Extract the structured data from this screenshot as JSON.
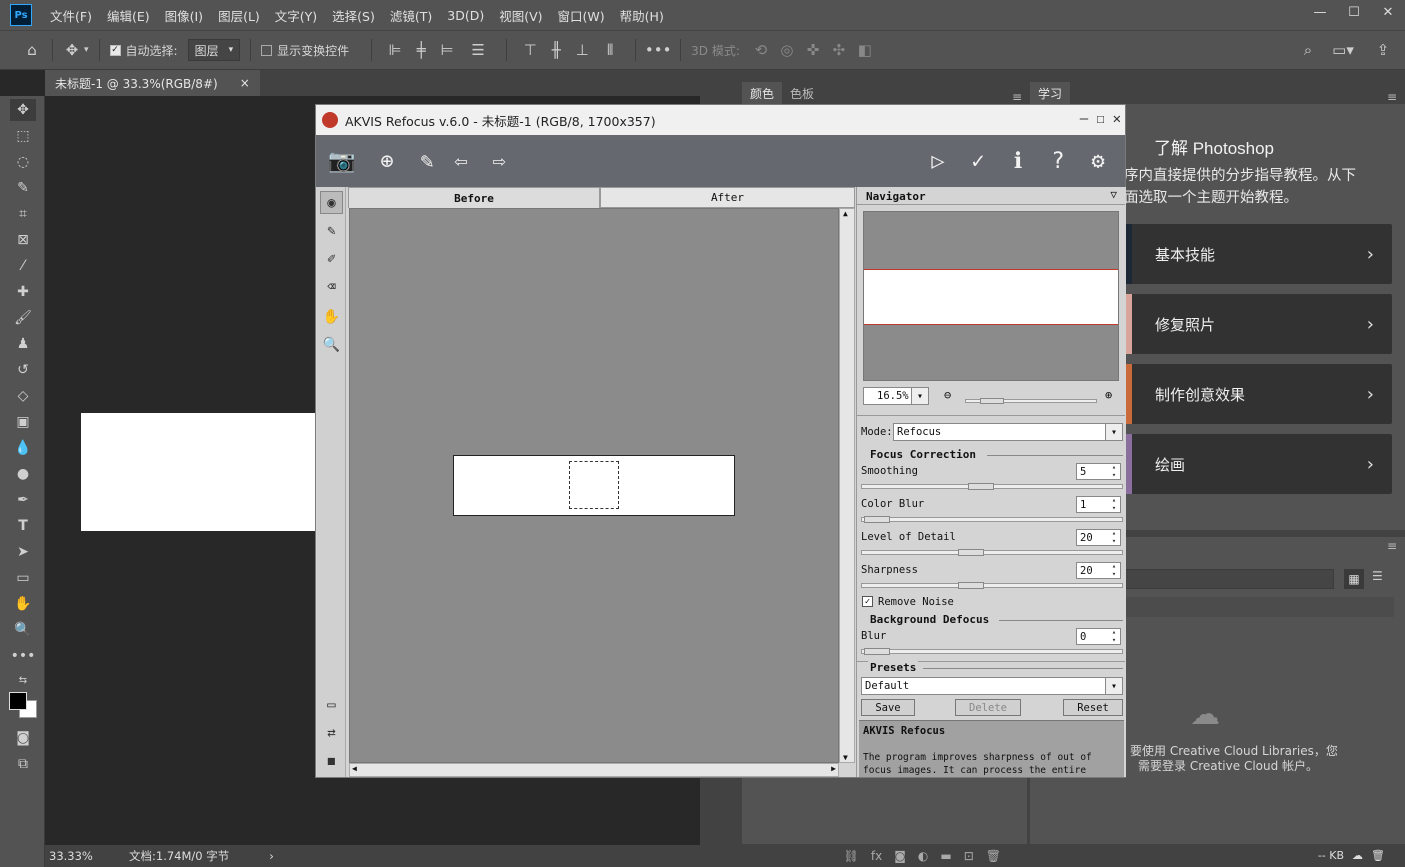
{
  "menubar": {
    "logo": "Ps",
    "items": [
      "文件(F)",
      "编辑(E)",
      "图像(I)",
      "图层(L)",
      "文字(Y)",
      "选择(S)",
      "滤镜(T)",
      "3D(D)",
      "视图(V)",
      "窗口(W)",
      "帮助(H)"
    ]
  },
  "options": {
    "auto_select_label": "自动选择:",
    "auto_select_target": "图层",
    "show_transform_label": "显示变换控件",
    "mode_3d_label": "3D 模式:"
  },
  "document": {
    "tab_title": "未标题-1 @ 33.3%(RGB/8#)",
    "tab_close": "×",
    "zoom": "33.33%",
    "doc_info": "文档:1.74M/0 字节",
    "status_arrow": "›"
  },
  "right_panels": {
    "color_tab": "颜色",
    "swatches_tab": "色板",
    "learn_tab": "学习",
    "learn_title": "了解 Photoshop",
    "learn_desc_line1": "序内直接提供的分步指导教程。从下",
    "learn_desc_line2": "面选取一个主题开始教程。",
    "learn_items": [
      "基本技能",
      "修复照片",
      "制作创意效果",
      "绘画"
    ],
    "lib_line1": "要使用 Creative Cloud Libraries，您",
    "lib_line2": "需要登录 Creative Cloud 帐户。",
    "lib_size": "-- KB"
  },
  "akvis": {
    "title": "AKVIS Refocus v.6.0 - 未标题-1 (RGB/8, 1700x357)",
    "tab_before": "Before",
    "tab_after": "After",
    "navigator_title": "Navigator",
    "zoom_value": "16.5%",
    "mode_label": "Mode:",
    "mode_value": "Refocus",
    "focus_correction": "Focus Correction",
    "smoothing_label": "Smoothing",
    "smoothing_value": "5",
    "color_blur_label": "Color Blur",
    "color_blur_value": "1",
    "level_detail_label": "Level of Detail",
    "level_detail_value": "20",
    "sharpness_label": "Sharpness",
    "sharpness_value": "20",
    "remove_noise_label": "Remove Noise",
    "background_defocus": "Background Defocus",
    "blur_label": "Blur",
    "blur_value": "0",
    "presets_title": "Presets",
    "preset_value": "Default",
    "save_btn": "Save",
    "delete_btn": "Delete",
    "reset_btn": "Reset",
    "help_title": "AKVIS Refocus",
    "help_text": "The program improves sharpness of out of focus images. It can process the entire"
  }
}
